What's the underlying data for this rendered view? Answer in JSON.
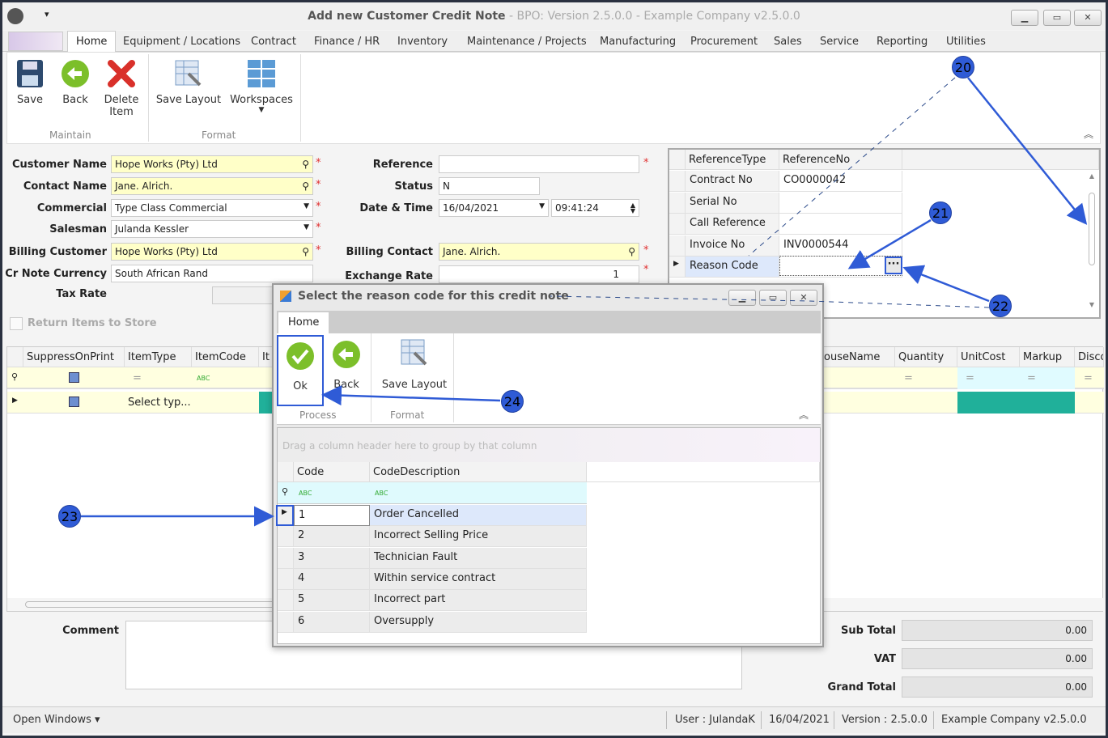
{
  "window": {
    "title": "Add new Customer Credit Note",
    "subtitle": " - BPO: Version 2.5.0.0 - Example Company v2.5.0.0",
    "min": "▁",
    "max": "▭",
    "close": "✕"
  },
  "menu": {
    "tabs": [
      "Home",
      "Equipment / Locations",
      "Contract",
      "Finance / HR",
      "Inventory",
      "Maintenance / Projects",
      "Manufacturing",
      "Procurement",
      "Sales",
      "Service",
      "Reporting",
      "Utilities"
    ]
  },
  "ribbon": {
    "save": "Save",
    "back": "Back",
    "delete": "Delete Item",
    "save_layout": "Save Layout",
    "workspaces": "Workspaces",
    "group_maintain": "Maintain",
    "group_format": "Format"
  },
  "form": {
    "customer_name_label": "Customer Name",
    "customer_name": "Hope Works (Pty) Ltd",
    "contact_name_label": "Contact Name",
    "contact_name": "Jane. Alrich.",
    "commercial_label": "Commercial",
    "commercial": "Type Class Commercial",
    "salesman_label": "Salesman",
    "salesman": "Julanda Kessler",
    "billing_customer_label": "Billing Customer",
    "billing_customer": "Hope Works (Pty) Ltd",
    "currency_label": "Cr Note Currency",
    "currency": "South African Rand",
    "tax_rate_label": "Tax Rate",
    "return_items_label": "Return Items to Store",
    "reference_label": "Reference",
    "reference": "",
    "status_label": "Status",
    "status": "N",
    "datetime_label": "Date & Time",
    "date": "16/04/2021",
    "time": "09:41:24",
    "billing_contact_label": "Billing Contact",
    "billing_contact": "Jane. Alrich.",
    "exchange_rate_label": "Exchange Rate",
    "exchange_rate": "1",
    "required": "*"
  },
  "references": {
    "headers": [
      "ReferenceType",
      "ReferenceNo"
    ],
    "rows": [
      [
        "Contract No",
        "CO0000042"
      ],
      [
        "Serial No",
        ""
      ],
      [
        "Call Reference",
        ""
      ],
      [
        "Invoice No",
        "INV0000544"
      ],
      [
        "Reason Code",
        ""
      ]
    ],
    "ellipsis": "···"
  },
  "items_grid": {
    "headers_left": [
      "SuppressOnPrint",
      "ItemType",
      "ItemCode",
      "It"
    ],
    "headers_right": [
      "ouseName",
      "Quantity",
      "UnitCost",
      "Markup",
      "Disco"
    ],
    "row_itemtype": "Select typ...",
    "abc": "ABC",
    "eq": "="
  },
  "totals": {
    "comment_label": "Comment",
    "subtotal_label": "Sub Total",
    "subtotal": "0.00",
    "vat_label": "VAT",
    "vat": "0.00",
    "grand_label": "Grand Total",
    "grand": "0.00"
  },
  "modal": {
    "title": "Select the reason code for this credit note",
    "tab": "Home",
    "ok": "Ok",
    "back": "Back",
    "save_layout": "Save Layout",
    "group_process": "Process",
    "group_format": "Format",
    "group_hint": "Drag a column header here to group by that column",
    "headers": [
      "Code",
      "CodeDescription"
    ],
    "rows": [
      {
        "code": "1",
        "desc": "Order Cancelled"
      },
      {
        "code": "2",
        "desc": "Incorrect Selling Price"
      },
      {
        "code": "3",
        "desc": "Technician Fault"
      },
      {
        "code": "4",
        "desc": "Within service contract"
      },
      {
        "code": "5",
        "desc": "Incorrect part"
      },
      {
        "code": "6",
        "desc": "Oversupply"
      }
    ]
  },
  "status_bar": {
    "open_windows": "Open Windows ▾",
    "user": "User : JulandaK",
    "date": "16/04/2021",
    "version": "Version : 2.5.0.0",
    "company": "Example Company v2.5.0.0"
  },
  "annotations": [
    "20",
    "21",
    "22",
    "23",
    "24"
  ]
}
